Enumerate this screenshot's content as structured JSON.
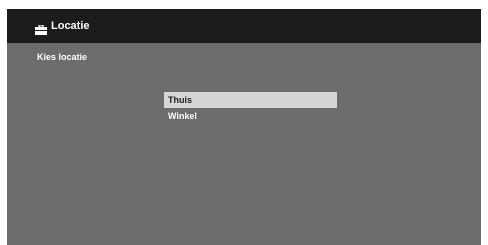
{
  "header": {
    "title": "Locatie",
    "icon": "briefcase-icon"
  },
  "subtitle": "Kies locatie",
  "options": [
    {
      "label": "Thuis",
      "selected": true
    },
    {
      "label": "Winkel",
      "selected": false
    }
  ],
  "colors": {
    "header_bg": "#1d1b1b",
    "screen_bg": "#6b6c6c",
    "selected_bg": "#d6d6d6",
    "text_light": "#ffffff",
    "text_dark": "#1a1a1a"
  }
}
